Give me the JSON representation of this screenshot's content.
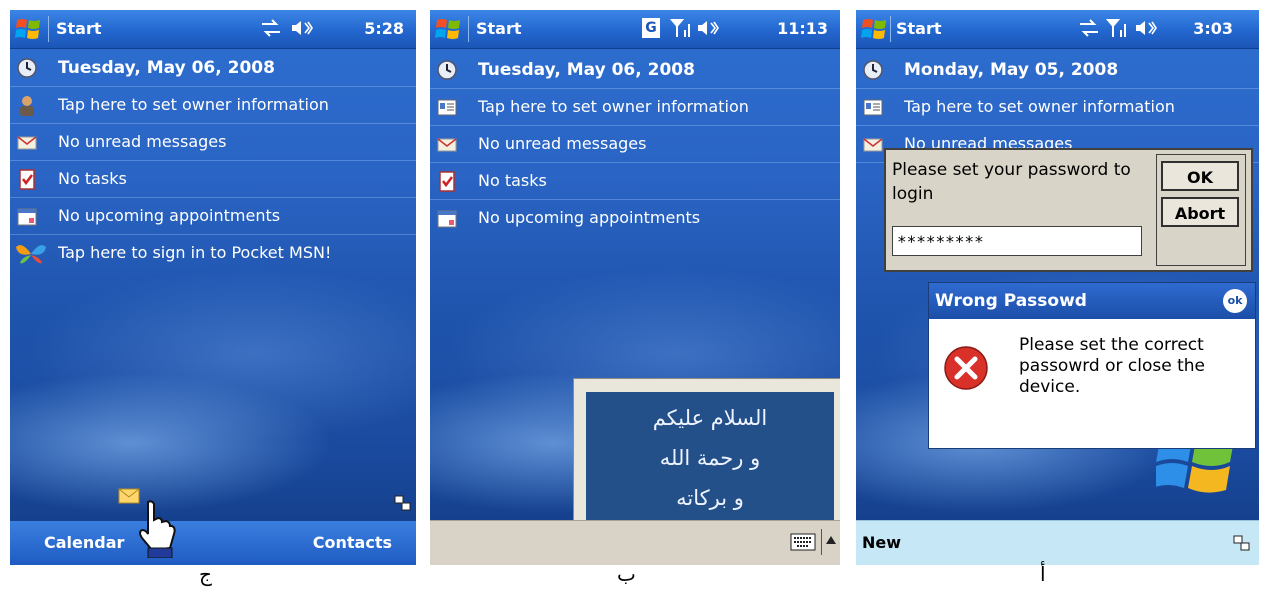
{
  "phone1": {
    "title": "Start",
    "time": "5:28",
    "rows": [
      {
        "icon": "clock-icon",
        "text": "Tuesday, May 06, 2008"
      },
      {
        "icon": "owner-icon",
        "text": "Tap here to set owner information"
      },
      {
        "icon": "envelope-icon",
        "text": "No unread messages"
      },
      {
        "icon": "tasks-icon",
        "text": "No tasks"
      },
      {
        "icon": "calendar-icon",
        "text": "No upcoming appointments"
      },
      {
        "icon": "msn-butterfly-icon",
        "text": "Tap here to sign in to Pocket MSN!"
      }
    ],
    "softkeys": {
      "left": "Calendar",
      "right": "Contacts"
    },
    "caption": "ج"
  },
  "phone2": {
    "title": "Start",
    "time": "11:13",
    "network": "G",
    "rows": [
      {
        "icon": "clock-icon",
        "text": "Tuesday, May 06, 2008"
      },
      {
        "icon": "contact-card-icon",
        "text": "Tap here to set owner information"
      },
      {
        "icon": "envelope-icon",
        "text": "No unread messages"
      },
      {
        "icon": "tasks-icon",
        "text": "No tasks"
      },
      {
        "icon": "calendar-icon",
        "text": "No upcoming appointments"
      }
    ],
    "arabic_lines": [
      "السلام عليكم",
      "و رحمة الله",
      "و بركاته"
    ],
    "caption": "ب"
  },
  "phone3": {
    "title": "Start",
    "time": "3:03",
    "rows": [
      {
        "icon": "clock-icon",
        "text": "Monday, May 05, 2008"
      },
      {
        "icon": "contact-card-icon",
        "text": "Tap here to set owner information"
      },
      {
        "icon": "envelope-icon",
        "text": "No unread messages"
      }
    ],
    "password_dialog": {
      "prompt": "Please set your password to login",
      "value": "*********",
      "ok": "OK",
      "abort": "Abort"
    },
    "error_dialog": {
      "title": "Wrong Passowd",
      "ok_badge": "ok",
      "message": "Please set the correct passowrd or close the device."
    },
    "softkey_left": "New",
    "caption": "أ"
  },
  "colors": {
    "title_blue": "#2367cf",
    "error_red": "#d9312a"
  }
}
